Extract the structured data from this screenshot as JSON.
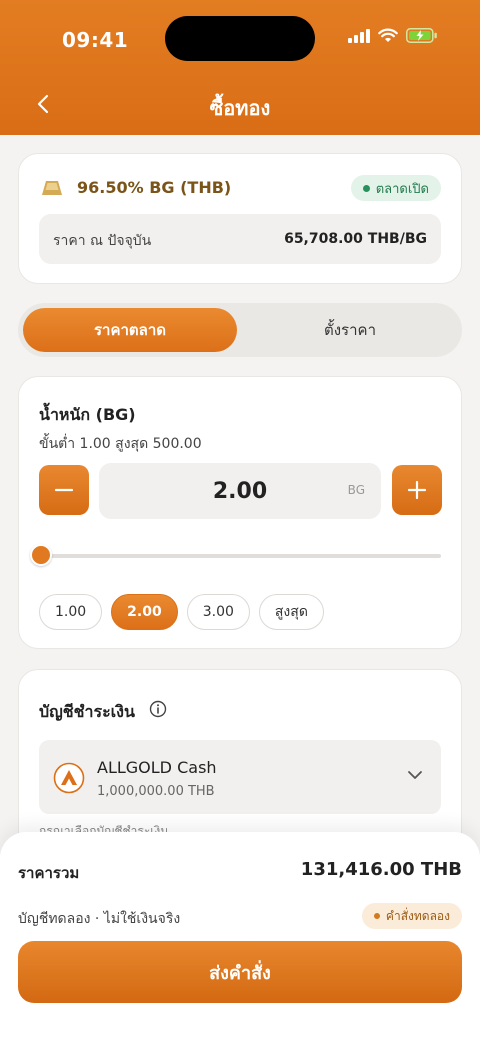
{
  "status_bar": {
    "time": "09:41"
  },
  "nav": {
    "title": "ซื้อทอง"
  },
  "asset": {
    "name": "96.50% BG (THB)",
    "market_status": "ตลาดเปิด",
    "price_label": "ราคา ณ ปัจจุบัน",
    "price_value": "65,708.00 THB/BG"
  },
  "order_tabs": [
    {
      "label": "ราคาตลาด",
      "active": true
    },
    {
      "label": "ตั้งราคา",
      "active": false
    }
  ],
  "weight": {
    "title": "น้ำหนัก (BG)",
    "range_text": "ขั้นต่ำ 1.00  สูงสุด 500.00",
    "value": "2.00",
    "unit": "BG",
    "slider_fraction": 0.004,
    "presets": [
      {
        "label": "1.00",
        "active": false
      },
      {
        "label": "2.00",
        "active": true
      },
      {
        "label": "3.00",
        "active": false
      },
      {
        "label": "สูงสุด",
        "active": false
      }
    ]
  },
  "payment": {
    "title": "บัญชีชำระเงิน",
    "account_name": "ALLGOLD Cash",
    "account_balance": "1,000,000.00 THB",
    "hint": "กรุณาเลือกบัญชีชำระเงิน"
  },
  "summary": {
    "total_label": "ราคารวม",
    "total_value": "131,416.00 THB",
    "demo_text": "บัญชีทดลอง · ไม่ใช้เงินจริง",
    "demo_badge": "คำสั่งทดลอง",
    "submit_label": "ส่งคำสั่ง"
  },
  "colors": {
    "accent": "#DC7019",
    "market_open": "#237A4D",
    "demo_badge": "#9C5C13"
  }
}
